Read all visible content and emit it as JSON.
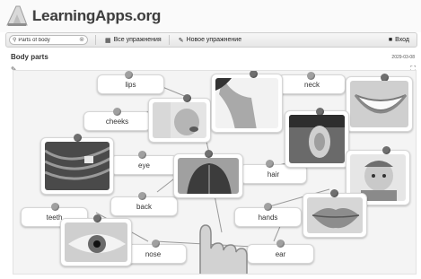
{
  "brand": {
    "name": "LearningApps.org"
  },
  "toolbar": {
    "search_value": "Parts of body",
    "all_exercises": "Все упражнения",
    "new_exercise": "Новое упражнение",
    "login": "Вход"
  },
  "page": {
    "title": "Body parts",
    "date": "2029-03-08"
  },
  "labels": {
    "lips": "lips",
    "cheeks": "cheeks",
    "neck": "neck",
    "eye": "eye",
    "hair": "hair",
    "back": "back",
    "teeth": "teeth",
    "hands": "hands",
    "nose": "nose",
    "ear": "ear"
  },
  "pictures": [
    "chin-neck-photo",
    "nose-photo",
    "smile-teeth-photo",
    "ear-photo",
    "hair-photo",
    "back-photo",
    "baby-cheeks-photo",
    "lips-photo",
    "eye-photo"
  ]
}
